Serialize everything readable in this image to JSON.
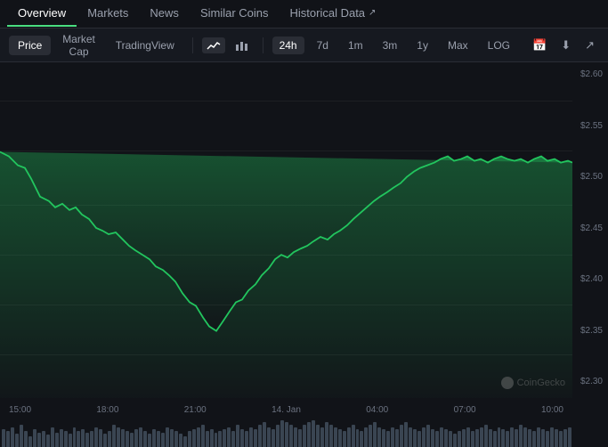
{
  "nav": {
    "tabs": [
      {
        "id": "overview",
        "label": "Overview",
        "active": true,
        "external": false
      },
      {
        "id": "markets",
        "label": "Markets",
        "active": false,
        "external": false
      },
      {
        "id": "news",
        "label": "News",
        "active": false,
        "external": false
      },
      {
        "id": "similar-coins",
        "label": "Similar Coins",
        "active": false,
        "external": false
      },
      {
        "id": "historical-data",
        "label": "Historical Data",
        "active": false,
        "external": true
      }
    ]
  },
  "toolbar": {
    "view_buttons": [
      {
        "id": "price",
        "label": "Price",
        "active": true
      },
      {
        "id": "market-cap",
        "label": "Market Cap",
        "active": false
      },
      {
        "id": "tradingview",
        "label": "TradingView",
        "active": false
      }
    ],
    "time_buttons": [
      {
        "id": "24h",
        "label": "24h",
        "active": true
      },
      {
        "id": "7d",
        "label": "7d",
        "active": false
      },
      {
        "id": "1m",
        "label": "1m",
        "active": false
      },
      {
        "id": "3m",
        "label": "3m",
        "active": false
      },
      {
        "id": "1y",
        "label": "1y",
        "active": false
      },
      {
        "id": "max",
        "label": "Max",
        "active": false
      },
      {
        "id": "log",
        "label": "LOG",
        "active": false
      }
    ]
  },
  "chart": {
    "y_labels": [
      "$2.60",
      "$2.55",
      "$2.50",
      "$2.45",
      "$2.40",
      "$2.35",
      "$2.30"
    ],
    "x_labels": [
      "15:00",
      "18:00",
      "21:00",
      "14. Jan",
      "04:00",
      "07:00",
      "10:00"
    ],
    "watermark": "CoinGecko",
    "accent_color": "#22c55e"
  }
}
